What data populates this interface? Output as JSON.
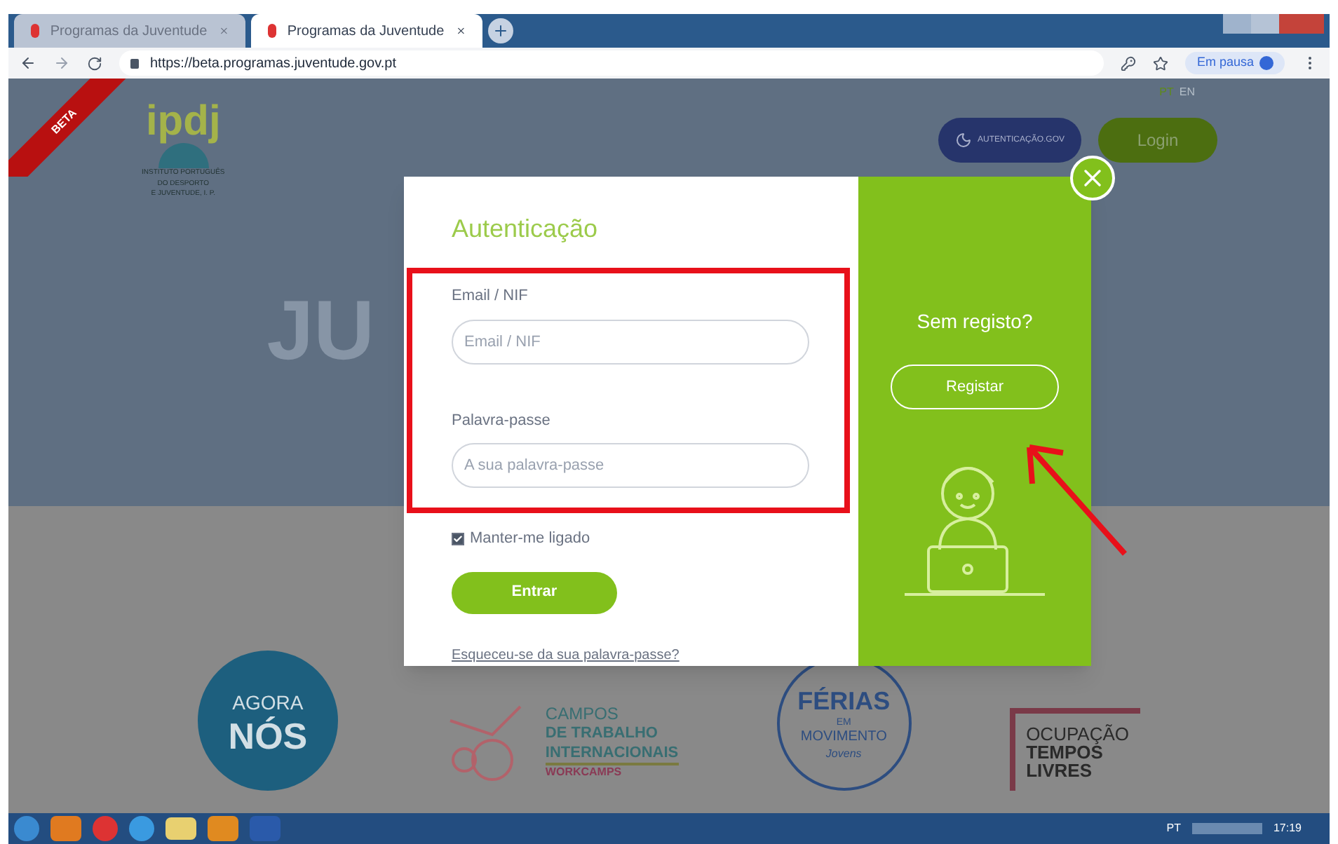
{
  "browser": {
    "tabs": [
      {
        "title": "Programas da Juventude",
        "selected": false
      },
      {
        "title": "Programas da Juventude",
        "selected": true
      }
    ],
    "url": "https://beta.programas.juventude.gov.pt",
    "profile": "Em pausa"
  },
  "header": {
    "ribbon": "BETA",
    "logo": {
      "mark": "ipdj",
      "lines": [
        "INSTITUTO PORTUGUÊS",
        "DO DESPORTO",
        "E JUVENTUDE, I. P."
      ]
    },
    "languages": [
      {
        "label": "PT",
        "selected": true
      },
      {
        "label": "EN",
        "selected": false
      }
    ],
    "gov_button": "AUTENTICAÇÃO.GOV",
    "login_button": "Login",
    "hero_text": "JU"
  },
  "programs": [
    {
      "kind": "round",
      "lines": [
        "AGORA",
        "NÓS"
      ]
    },
    {
      "kind": "workcamps",
      "lines": [
        "CAMPOS",
        "DE TRABALHO",
        "INTERNACIONAIS",
        "WORKCAMPS"
      ]
    },
    {
      "kind": "ferias",
      "lines": [
        "FÉRIAS",
        "EM",
        "MOVIMENTO",
        "Jovens"
      ]
    },
    {
      "kind": "otl",
      "lines": [
        "OCUPAÇÃO",
        "TEMPOS",
        "LIVRES"
      ]
    }
  ],
  "login_modal": {
    "title": "Autenticação",
    "fields": [
      {
        "label": "Email / NIF",
        "placeholder": "Email / NIF"
      },
      {
        "label": "Palavra-passe",
        "placeholder": "A sua palavra-passe"
      }
    ],
    "remember": {
      "label": "Manter-me ligado",
      "checked": true
    },
    "submit": "Entrar",
    "forgot_link": "Esqueceu-se da sua palavra-passe?",
    "register_prompt": "Sem registo?",
    "register_button": "Registar"
  },
  "taskbar": {
    "language": "PT",
    "time": "17:19"
  }
}
